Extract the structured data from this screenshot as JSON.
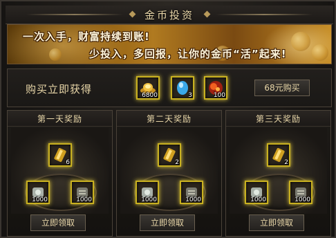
{
  "window": {
    "title": "金币投资"
  },
  "banner": {
    "line1": "一次入手，财富持续到账!",
    "line2": "少投入，多回报，让你的金币“活”起来!"
  },
  "purchase": {
    "label": "购买立即获得",
    "items": [
      {
        "icon": "gold-ingot-icon",
        "qty": "6800"
      },
      {
        "icon": "blue-gem-icon",
        "qty": "3"
      },
      {
        "icon": "fire-orb-icon",
        "qty": "100"
      }
    ],
    "buy_button": "68元购买"
  },
  "days": [
    {
      "title": "第一天奖励",
      "items": [
        {
          "icon": "gold-bar-icon",
          "qty": "6"
        },
        {
          "icon": "silver-scroll-icon",
          "qty": "1000"
        },
        {
          "icon": "grey-scroll-icon",
          "qty": "1000"
        }
      ],
      "claim_button": "立即领取"
    },
    {
      "title": "第二天奖励",
      "items": [
        {
          "icon": "gold-bar-icon",
          "qty": "2"
        },
        {
          "icon": "silver-scroll-icon",
          "qty": "1000"
        },
        {
          "icon": "grey-scroll-icon",
          "qty": "1000"
        }
      ],
      "claim_button": "立即领取"
    },
    {
      "title": "第三天奖励",
      "items": [
        {
          "icon": "gold-bar-icon",
          "qty": "2"
        },
        {
          "icon": "silver-scroll-icon",
          "qty": "1000"
        },
        {
          "icon": "grey-scroll-icon",
          "qty": "1000"
        }
      ],
      "claim_button": "立即领取"
    }
  ],
  "colors": {
    "accent": "#e8d6a8",
    "slot_border": "#c8b020",
    "banner": "#b07a20"
  }
}
